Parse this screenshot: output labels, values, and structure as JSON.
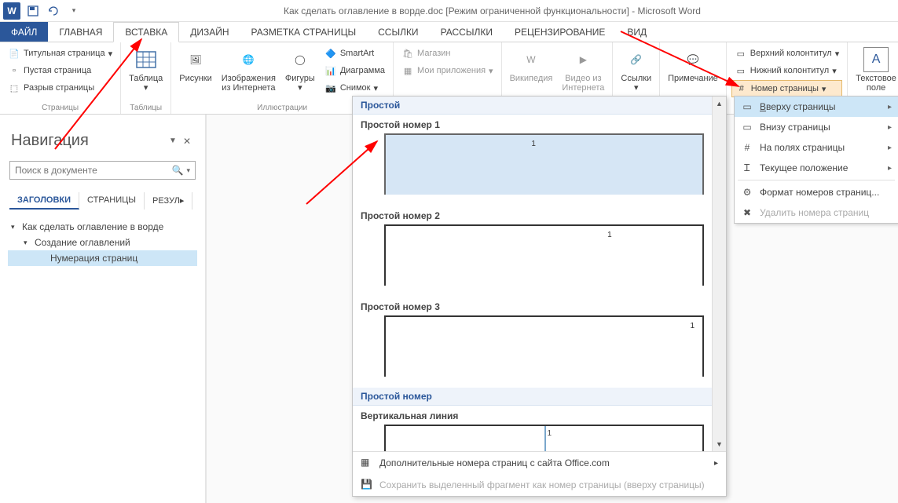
{
  "title": "Как сделать оглавление в ворде.doc [Режим ограниченной функциональности] - Microsoft Word",
  "tabs": {
    "file": "ФАЙЛ",
    "home": "ГЛАВНАЯ",
    "insert": "ВСТАВКА",
    "design": "ДИЗАЙН",
    "layout": "РАЗМЕТКА СТРАНИЦЫ",
    "references": "ССЫЛКИ",
    "mailings": "РАССЫЛКИ",
    "review": "РЕЦЕНЗИРОВАНИЕ",
    "view": "ВИД"
  },
  "ribbon": {
    "pages": {
      "cover": "Титульная страница",
      "blank": "Пустая страница",
      "break": "Разрыв страницы",
      "group": "Страницы"
    },
    "tables": {
      "table": "Таблица",
      "group": "Таблицы"
    },
    "illustrations": {
      "pictures": "Рисунки",
      "online": "Изображения\nиз Интернета",
      "shapes": "Фигуры",
      "smartart": "SmartArt",
      "chart": "Диаграмма",
      "screenshot": "Снимок",
      "group": "Иллюстрации"
    },
    "apps": {
      "store": "Магазин",
      "myapps": "Мои приложения"
    },
    "media": {
      "wiki": "Википедия",
      "video": "Видео из\nИнтернета"
    },
    "links": {
      "links": "Ссылки"
    },
    "comments": {
      "comment": "Примечание"
    },
    "headerfooter": {
      "header": "Верхний колонтитул",
      "footer": "Нижний колонтитул",
      "pagenum": "Номер страницы"
    },
    "text": {
      "textbox": "Текстовое\nполе"
    }
  },
  "nav": {
    "title": "Навигация",
    "search_placeholder": "Поиск в документе",
    "tabs": {
      "headings": "ЗАГОЛОВКИ",
      "pages": "СТРАНИЦЫ",
      "results": "РЕЗУЛ"
    },
    "tree": {
      "l1": "Как сделать оглавление в ворде",
      "l2": "Создание оглавлений",
      "l3": "Нумерация страниц"
    }
  },
  "pn_menu": {
    "top": "Вверху страницы",
    "bottom": "Внизу страницы",
    "margins": "На полях страницы",
    "current": "Текущее положение",
    "format": "Формат номеров страниц...",
    "remove": "Удалить номера страниц"
  },
  "gallery": {
    "cat_simple": "Простой",
    "opt1": "Простой номер 1",
    "opt2": "Простой номер 2",
    "opt3": "Простой номер 3",
    "cat_simple_num": "Простой номер",
    "opt_vline": "Вертикальная линия",
    "num": "1",
    "more": "Дополнительные номера страниц с сайта Office.com",
    "save_sel": "Сохранить выделенный фрагмент как номер страницы (вверху страницы)"
  }
}
